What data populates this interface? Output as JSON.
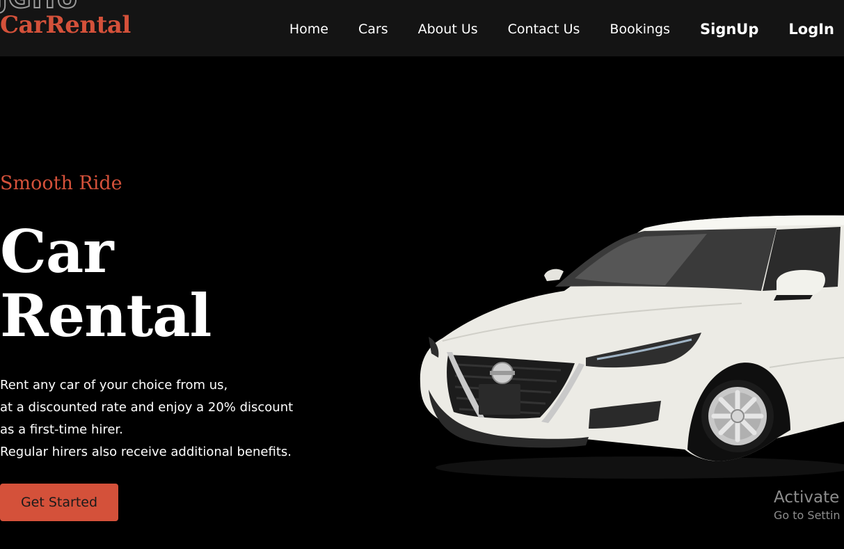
{
  "header": {
    "logo_overlay": "JGHU",
    "logo": "CarRental",
    "nav": {
      "home": "Home",
      "cars": "Cars",
      "about": "About Us",
      "contact": "Contact Us",
      "bookings": "Bookings",
      "signup": "SignUp",
      "login": "LogIn"
    }
  },
  "hero": {
    "eyebrow": "Smooth Ride",
    "title_line1": "Car",
    "title_line2": "Rental",
    "text_lines": [
      "Rent any car of your choice from us,",
      "at a discounted rate and enjoy a 20% discount",
      "as a first-time hirer.",
      "Regular hirers also receive additional benefits."
    ],
    "cta_label": "Get Started"
  },
  "watermark": {
    "line1": "Activate",
    "line2": "Go to Settin"
  },
  "colors": {
    "accent": "#d4513a",
    "header_bg": "#141414",
    "page_bg": "#000000",
    "car_body": "#ecebe5"
  },
  "icons": {
    "car_image": "white-sedan-car-image"
  }
}
